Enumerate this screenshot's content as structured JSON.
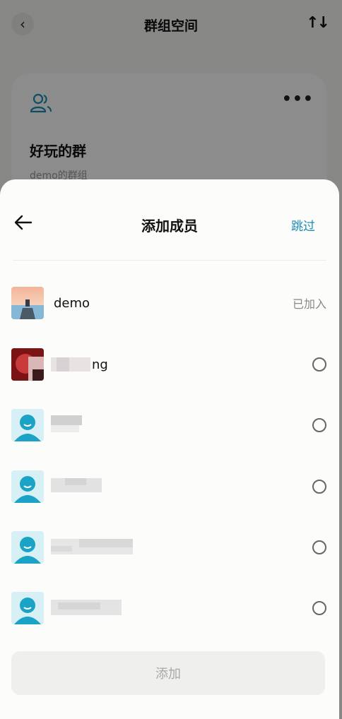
{
  "background": {
    "title": "群组空间",
    "group_name": "好玩的群",
    "group_desc": "demo的群组"
  },
  "sheet": {
    "title": "添加成员",
    "skip_label": "跳过",
    "add_label": "添加"
  },
  "members": [
    {
      "name": "demo",
      "status": "已加入",
      "avatar": "photo-pier"
    },
    {
      "name": "ng",
      "status": "",
      "avatar": "photo-red"
    },
    {
      "name": "",
      "status": "",
      "avatar": "default-user"
    },
    {
      "name": "",
      "status": "",
      "avatar": "default-user"
    },
    {
      "name": "",
      "status": "",
      "avatar": "default-user"
    },
    {
      "name": "",
      "status": "",
      "avatar": "default-user"
    }
  ],
  "colors": {
    "accent": "#1a8cb5",
    "avatar_bg": "#d7f0f5",
    "avatar_fg": "#1aa3c4"
  }
}
